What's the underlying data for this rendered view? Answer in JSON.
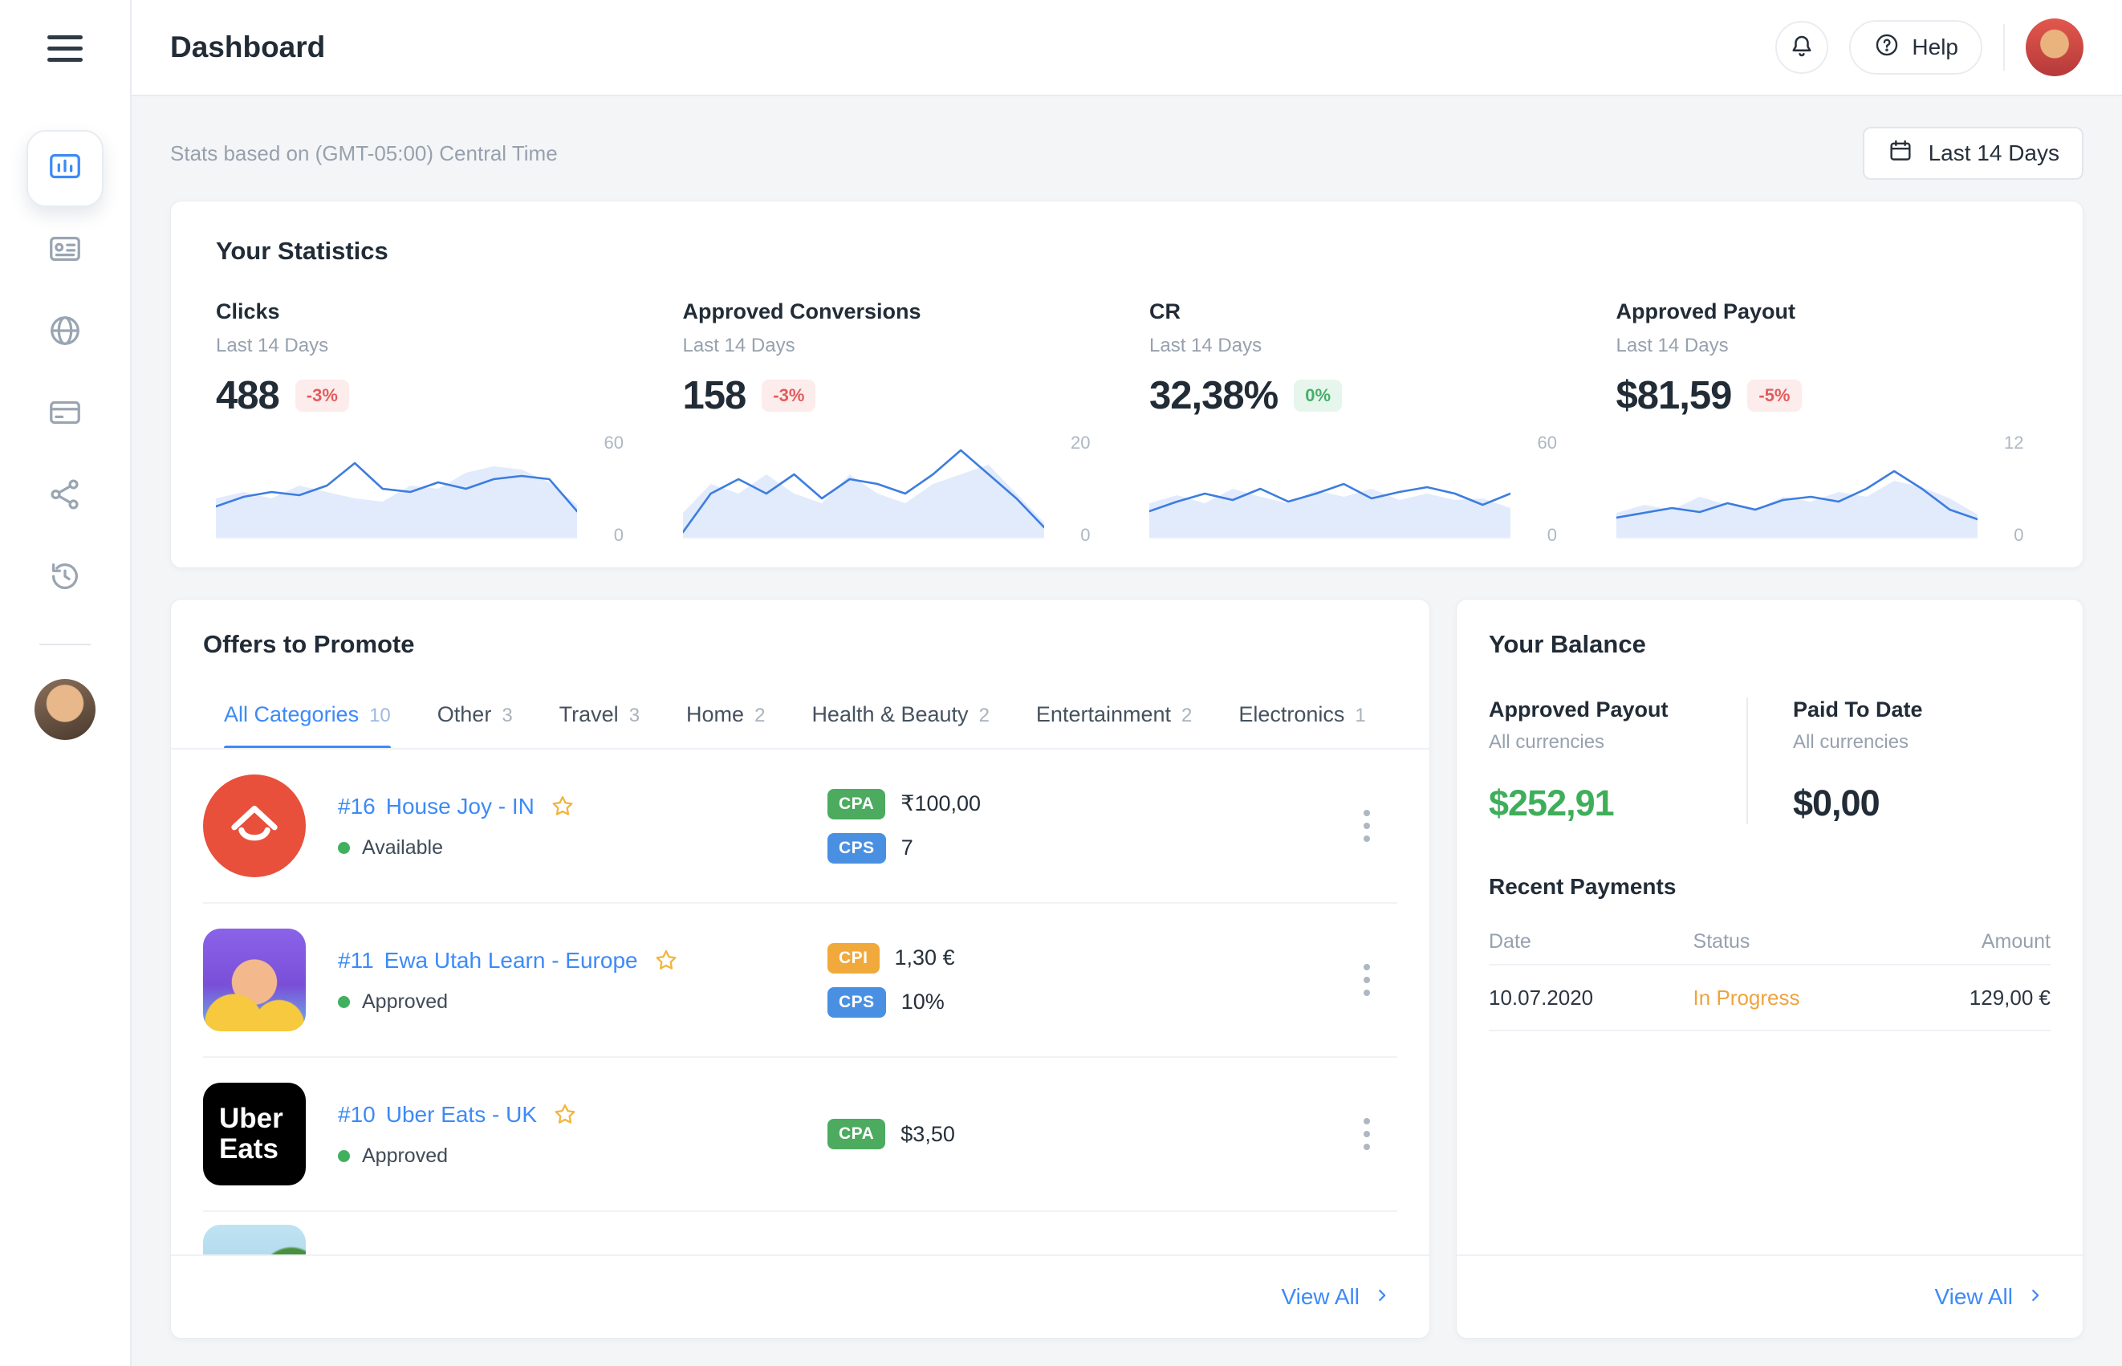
{
  "topbar": {
    "title": "Dashboard",
    "help_label": "Help",
    "icons": {
      "menu": "hamburger-icon",
      "notifications": "bell-icon",
      "help": "question-circle-icon",
      "avatar": "user-avatar"
    }
  },
  "sidebar": {
    "items": [
      {
        "icon": "dashboard-icon",
        "active": true
      },
      {
        "icon": "id-card-icon",
        "active": false
      },
      {
        "icon": "globe-icon",
        "active": false
      },
      {
        "icon": "credit-card-icon",
        "active": false
      },
      {
        "icon": "links-icon",
        "active": false
      },
      {
        "icon": "history-icon",
        "active": false
      }
    ]
  },
  "toolbar": {
    "stats_note": "Stats based on (GMT-05:00) Central Time",
    "date_range_label": "Last 14 Days",
    "date_range_icon": "calendar-icon"
  },
  "statistics": {
    "title": "Your Statistics",
    "stats": [
      {
        "label": "Clicks",
        "period": "Last 14 Days",
        "value": "488",
        "delta": "-3%",
        "delta_type": "negative",
        "y_max": "60",
        "y_min": "0"
      },
      {
        "label": "Approved Conversions",
        "period": "Last 14 Days",
        "value": "158",
        "delta": "-3%",
        "delta_type": "negative",
        "y_max": "20",
        "y_min": "0"
      },
      {
        "label": "CR",
        "period": "Last 14 Days",
        "value": "32,38%",
        "delta": "0%",
        "delta_type": "positive",
        "y_max": "60",
        "y_min": "0"
      },
      {
        "label": "Approved Payout",
        "period": "Last 14 Days",
        "value": "$81,59",
        "delta": "-5%",
        "delta_type": "negative",
        "y_max": "12",
        "y_min": "0"
      }
    ]
  },
  "chart_data": [
    {
      "type": "area",
      "title": "Clicks sparkline",
      "x": [
        1,
        2,
        3,
        4,
        5,
        6,
        7,
        8,
        9,
        10,
        11,
        12,
        13,
        14
      ],
      "ylim": [
        0,
        60
      ],
      "series": [
        {
          "name": "filled",
          "values": [
            24,
            28,
            24,
            32,
            28,
            24,
            22,
            32,
            30,
            40,
            44,
            42,
            34,
            20
          ]
        },
        {
          "name": "line",
          "values": [
            19,
            25,
            28,
            26,
            32,
            46,
            30,
            28,
            34,
            30,
            36,
            38,
            36,
            16
          ]
        }
      ]
    },
    {
      "type": "area",
      "title": "Approved Conversions sparkline",
      "x": [
        1,
        2,
        3,
        4,
        5,
        6,
        7,
        8,
        9,
        10,
        11,
        12,
        13,
        14
      ],
      "ylim": [
        0,
        20
      ],
      "series": [
        {
          "name": "filled",
          "values": [
            5,
            11,
            9,
            13,
            9,
            7,
            13,
            9,
            7,
            11,
            13,
            15,
            9,
            3
          ]
        },
        {
          "name": "line",
          "values": [
            1,
            9,
            12,
            9,
            13,
            8,
            12,
            11,
            9,
            13,
            18,
            13,
            8,
            2
          ]
        }
      ]
    },
    {
      "type": "area",
      "title": "CR sparkline",
      "x": [
        1,
        2,
        3,
        4,
        5,
        6,
        7,
        8,
        9,
        10,
        11,
        12,
        13,
        14
      ],
      "ylim": [
        0,
        60
      ],
      "series": [
        {
          "name": "filled",
          "values": [
            21,
            26,
            21,
            30,
            25,
            21,
            29,
            25,
            30,
            23,
            27,
            23,
            24,
            18
          ]
        },
        {
          "name": "line",
          "values": [
            16,
            22,
            27,
            23,
            30,
            22,
            27,
            33,
            24,
            28,
            31,
            27,
            20,
            27
          ]
        }
      ]
    },
    {
      "type": "area",
      "title": "Approved Payout sparkline",
      "x": [
        1,
        2,
        3,
        4,
        5,
        6,
        7,
        8,
        9,
        10,
        11,
        12,
        13,
        14
      ],
      "ylim": [
        0,
        12
      ],
      "series": [
        {
          "name": "filled",
          "values": [
            3,
            4,
            3.4,
            5,
            4,
            3.4,
            5,
            4.4,
            5.6,
            5,
            7,
            6.2,
            4.8,
            2.8
          ]
        },
        {
          "name": "line",
          "values": [
            2.4,
            3,
            3.6,
            3.1,
            4.2,
            3.4,
            4.6,
            5,
            4.4,
            6,
            8.2,
            6,
            3.4,
            2.2
          ]
        }
      ]
    }
  ],
  "offers": {
    "title": "Offers to Promote",
    "tabs": [
      {
        "label": "All Categories",
        "count": "10",
        "active": true
      },
      {
        "label": "Other",
        "count": "3",
        "active": false
      },
      {
        "label": "Travel",
        "count": "3",
        "active": false
      },
      {
        "label": "Home",
        "count": "2",
        "active": false
      },
      {
        "label": "Health & Beauty",
        "count": "2",
        "active": false
      },
      {
        "label": "Entertainment",
        "count": "2",
        "active": false
      },
      {
        "label": "Electronics",
        "count": "1",
        "active": false
      }
    ],
    "items": [
      {
        "id": "#16",
        "name": "House Joy - IN",
        "status": "Available",
        "badges": [
          {
            "type": "CPA",
            "value": "₹100,00"
          },
          {
            "type": "CPS",
            "value": "7"
          }
        ]
      },
      {
        "id": "#11",
        "name": "Ewa Utah Learn - Europe",
        "status": "Approved",
        "badges": [
          {
            "type": "CPI",
            "value": "1,30 €"
          },
          {
            "type": "CPS",
            "value": "10%"
          }
        ]
      },
      {
        "id": "#10",
        "name": "Uber Eats - UK",
        "status": "Approved",
        "logo_text": "Uber Eats",
        "badges": [
          {
            "type": "CPA",
            "value": "$3,50"
          }
        ]
      }
    ],
    "view_all": "View All"
  },
  "balance": {
    "title": "Your Balance",
    "approved_payout": {
      "label": "Approved Payout",
      "sub": "All currencies",
      "value": "$252,91"
    },
    "paid_to_date": {
      "label": "Paid To Date",
      "sub": "All currencies",
      "value": "$0,00"
    },
    "recent_payments": {
      "title": "Recent Payments",
      "columns": [
        "Date",
        "Status",
        "Amount"
      ],
      "rows": [
        {
          "date": "10.07.2020",
          "status": "In Progress",
          "amount": "129,00 €"
        }
      ]
    },
    "view_all": "View All"
  },
  "colors": {
    "accent_blue": "#3d8af7",
    "chart_line": "#3d7de0",
    "chart_fill": "rgba(72,133,237,0.16)",
    "positive_green": "#41b05e",
    "balance_green": "#3fae5a",
    "negative_red": "#e25c5c",
    "warning_orange": "#f0a33f",
    "badge_cpa": "#4cab5f",
    "badge_cps": "#4a90e2",
    "badge_cpi": "#f0a93a",
    "page_bg": "#f4f5f7"
  }
}
